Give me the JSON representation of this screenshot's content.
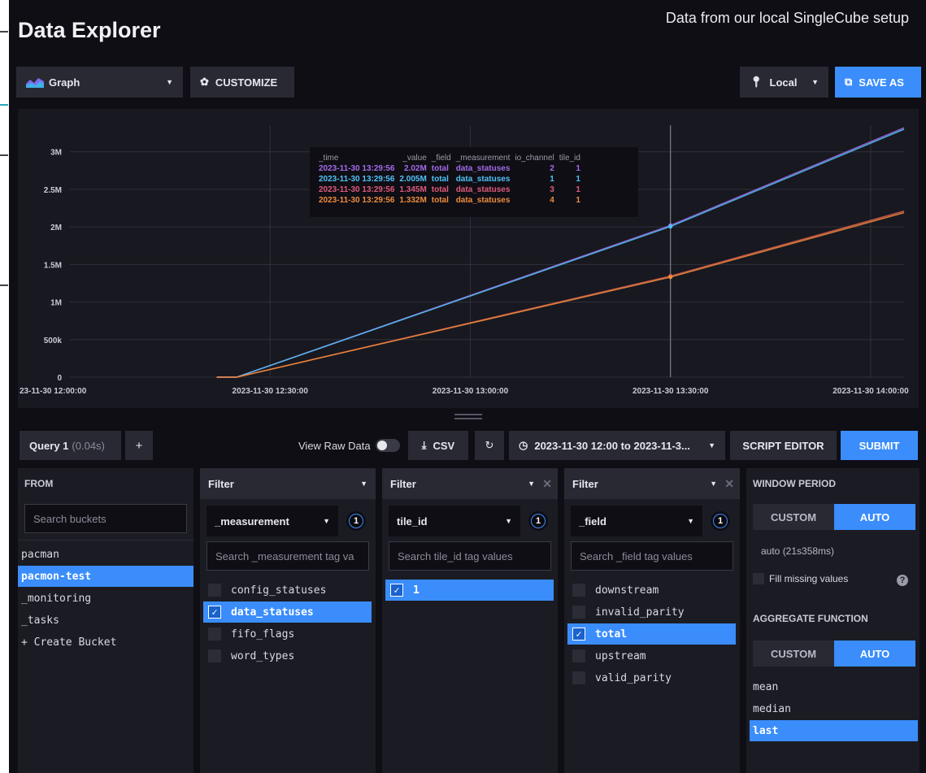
{
  "header": {
    "title": "Data Explorer",
    "caption": "Data from our local SingleCube setup"
  },
  "toolbar": {
    "graph_label": "Graph",
    "customize_label": "CUSTOMIZE",
    "timezone_label": "Local",
    "save_as_label": "SAVE AS"
  },
  "chart_data": {
    "type": "line",
    "x_tick_labels": [
      "23-11-30 12:00:00",
      "2023-11-30 12:30:00",
      "2023-11-30 13:00:00",
      "2023-11-30 13:30:00",
      "2023-11-30 14:00:00"
    ],
    "y_tick_labels": [
      "0",
      "500k",
      "1M",
      "1.5M",
      "2M",
      "2.5M",
      "3M"
    ],
    "ylim": [
      0,
      3300000
    ],
    "xlim_minutes": [
      0,
      125
    ],
    "grid": true,
    "series": [
      {
        "color": "#a36be8",
        "x": [
          22,
          25,
          90,
          125
        ],
        "y": [
          0,
          0,
          2020000,
          3320000
        ]
      },
      {
        "color": "#4fc3f7",
        "x": [
          22,
          25,
          90,
          125
        ],
        "y": [
          0,
          0,
          2005000,
          3300000
        ]
      },
      {
        "color": "#e06050",
        "x": [
          22,
          25,
          90,
          125
        ],
        "y": [
          0,
          0,
          1345000,
          2210000
        ]
      },
      {
        "color": "#ef8c3c",
        "x": [
          22,
          25,
          90,
          125
        ],
        "y": [
          0,
          0,
          1332000,
          2190000
        ]
      }
    ],
    "hover_x": 90,
    "tooltip": {
      "headers": [
        "_time",
        "_value",
        "_field",
        "_measurement",
        "io_channel",
        "tile_id"
      ],
      "rows": [
        {
          "time": "2023-11-30 13:29:56",
          "value": "2.02M",
          "field": "total",
          "measurement": "data_statuses",
          "io_channel": "2",
          "tile_id": "1",
          "color": "#a36be8"
        },
        {
          "time": "2023-11-30 13:29:56",
          "value": "2.005M",
          "field": "total",
          "measurement": "data_statuses",
          "io_channel": "1",
          "tile_id": "1",
          "color": "#4fc3f7"
        },
        {
          "time": "2023-11-30 13:29:56",
          "value": "1.345M",
          "field": "total",
          "measurement": "data_statuses",
          "io_channel": "3",
          "tile_id": "1",
          "color": "#e05a7c"
        },
        {
          "time": "2023-11-30 13:29:56",
          "value": "1.332M",
          "field": "total",
          "measurement": "data_statuses",
          "io_channel": "4",
          "tile_id": "1",
          "color": "#ef8c3c"
        }
      ]
    }
  },
  "query": {
    "tab_label": "Query 1",
    "tab_time": "(0.04s)",
    "add_label": "+",
    "raw_data_label": "View Raw Data",
    "csv_label": "CSV",
    "time_range_label": "2023-11-30 12:00 to 2023-11-3...",
    "script_editor_label": "SCRIPT EDITOR",
    "submit_label": "SUBMIT"
  },
  "from_panel": {
    "title": "FROM",
    "search_placeholder": "Search buckets",
    "buckets": [
      "pacman",
      "pacmon-test",
      "_monitoring",
      "_tasks",
      "+ Create Bucket"
    ],
    "selected_index": 1
  },
  "filters": [
    {
      "head": "Filter",
      "key": "_measurement",
      "count": "1",
      "search_placeholder": "Search _measurement tag va",
      "values": [
        {
          "label": "config_statuses",
          "checked": false
        },
        {
          "label": "data_statuses",
          "checked": true
        },
        {
          "label": "fifo_flags",
          "checked": false
        },
        {
          "label": "word_types",
          "checked": false
        }
      ]
    },
    {
      "head": "Filter",
      "key": "tile_id",
      "count": "1",
      "search_placeholder": "Search tile_id tag values",
      "values": [
        {
          "label": "1",
          "checked": true
        }
      ]
    },
    {
      "head": "Filter",
      "key": "_field",
      "count": "1",
      "search_placeholder": "Search _field tag values",
      "values": [
        {
          "label": "downstream",
          "checked": false
        },
        {
          "label": "invalid_parity",
          "checked": false
        },
        {
          "label": "total",
          "checked": true
        },
        {
          "label": "upstream",
          "checked": false
        },
        {
          "label": "valid_parity",
          "checked": false
        }
      ]
    }
  ],
  "window_panel": {
    "title": "WINDOW PERIOD",
    "custom_label": "CUSTOM",
    "auto_label": "AUTO",
    "period_text": "auto (21s358ms)",
    "fill_missing_label": "Fill missing values",
    "aggregate_title": "AGGREGATE FUNCTION",
    "functions": [
      "mean",
      "median",
      "last"
    ],
    "selected_function_index": 2
  },
  "colors": {
    "accent": "#3a8dfb",
    "background": "#0f0e15",
    "panel": "#1b1b23"
  }
}
